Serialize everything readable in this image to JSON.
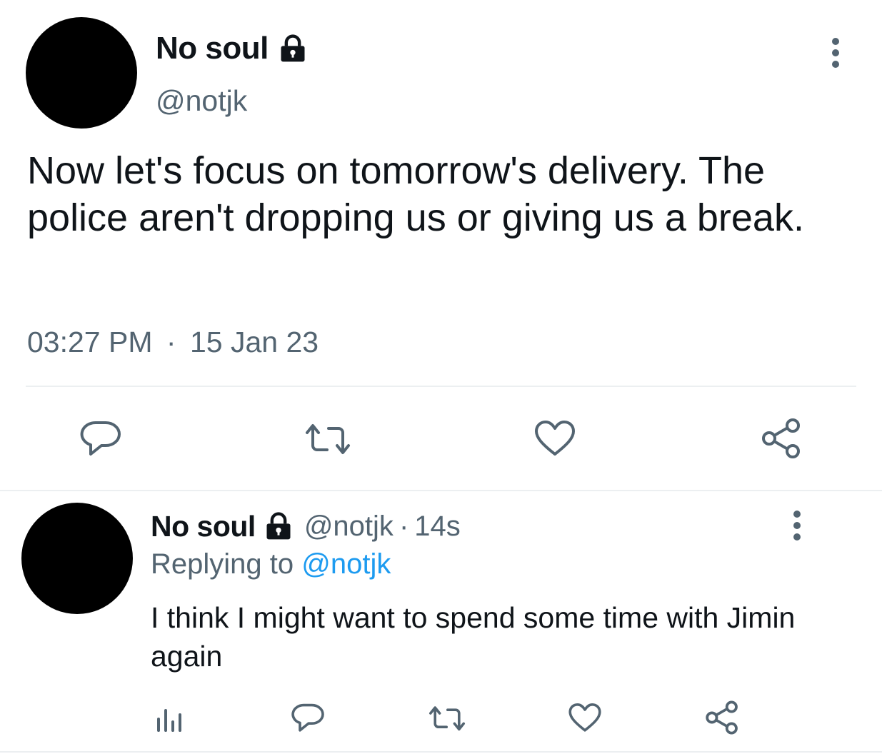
{
  "main_tweet": {
    "display_name": "No soul",
    "handle": "@notjk",
    "text": "Now let's focus on tomorrow's delivery. The police aren't dropping us or giving us a break.",
    "time": "03:27 PM",
    "separator": "·",
    "date": "15 Jan 23",
    "icons": {
      "lock": "lock-icon",
      "more": "more-vertical-icon",
      "reply": "reply-icon",
      "retweet": "retweet-icon",
      "like": "heart-icon",
      "share": "share-icon"
    }
  },
  "reply_tweet": {
    "display_name": "No soul",
    "handle": "@notjk",
    "separator": "·",
    "age": "14s",
    "replying_prefix": "Replying to",
    "replying_handle": "@notjk",
    "text": "I think I might want to spend some time with Jimin again",
    "icons": {
      "lock": "lock-icon",
      "more": "more-vertical-icon",
      "analytics": "analytics-icon",
      "reply": "reply-icon",
      "retweet": "retweet-icon",
      "like": "heart-icon",
      "share": "share-icon"
    }
  },
  "colors": {
    "text_primary": "#0f1419",
    "text_secondary": "#536471",
    "link": "#1d9bf0",
    "divider": "#eceff1"
  }
}
